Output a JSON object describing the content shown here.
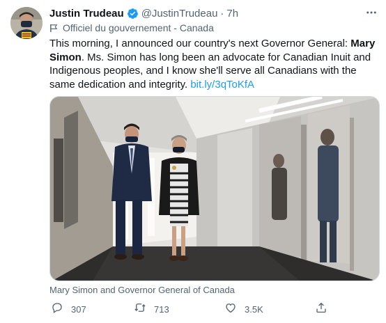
{
  "author": {
    "name": "Justin Trudeau",
    "handle": "@JustinTrudeau",
    "separator": "·",
    "time": "7h"
  },
  "label": "Officiel du gouvernement - Canada",
  "body": {
    "intro": "This morning, I announced our country's next Governor General: ",
    "bold_name": "Mary Simon",
    "rest": ". Ms. Simon has long been an advocate for Canadian Inuit and Indigenous peoples, and I know she'll serve all Canadians with the same dedication and integrity. ",
    "link": "bit.ly/3qToKfA"
  },
  "caption": "Mary Simon and Governor General of Canada",
  "actions": {
    "replies": "307",
    "retweets": "713",
    "likes": "3.5K"
  },
  "icons": [
    "verified-icon",
    "more-icon",
    "flag-icon",
    "reply-icon",
    "retweet-icon",
    "like-icon",
    "share-icon"
  ],
  "colors": {
    "accent": "#1d9bf0",
    "secondary_text": "#536471"
  }
}
